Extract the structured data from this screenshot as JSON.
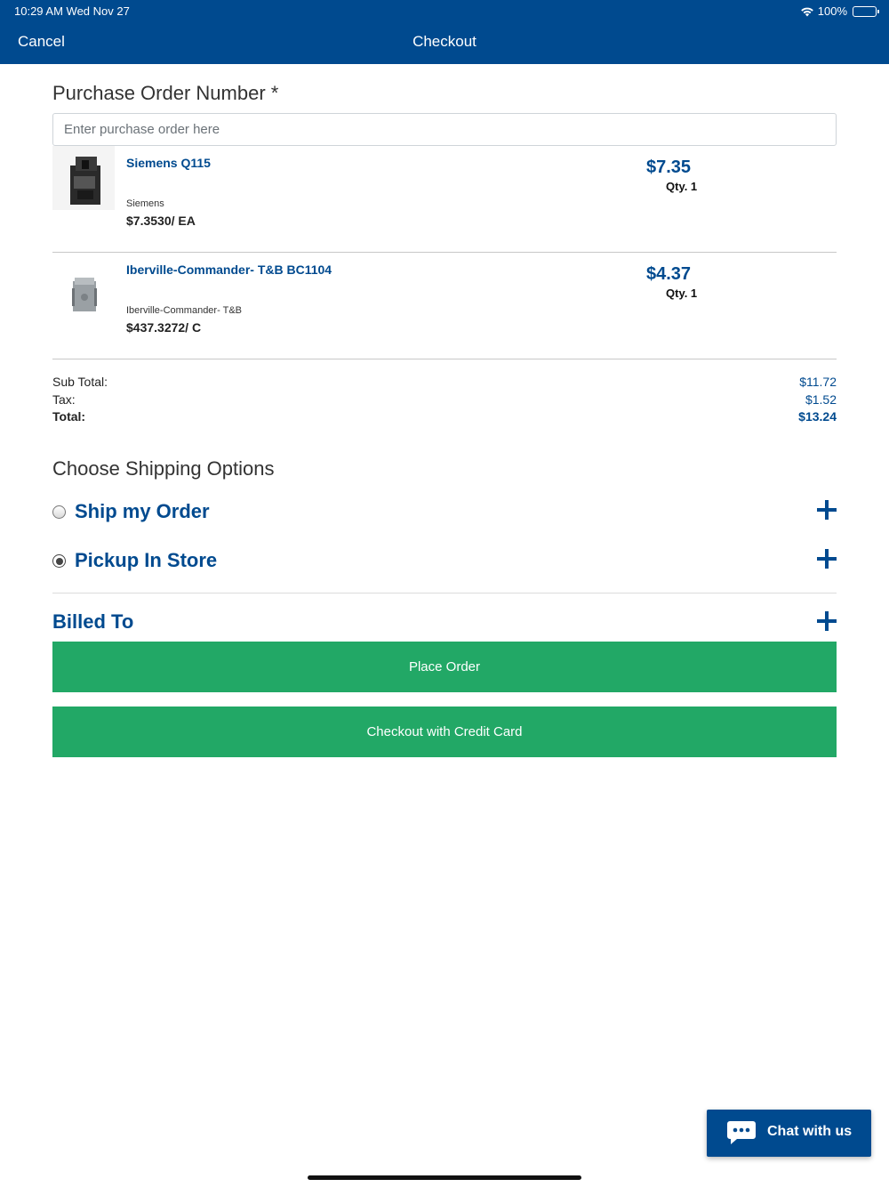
{
  "status_bar": {
    "time": "10:29 AM   Wed Nov 27",
    "battery": "100%"
  },
  "nav": {
    "cancel": "Cancel",
    "title": "Checkout"
  },
  "purchase_order": {
    "label": "Purchase Order Number *",
    "placeholder": "Enter purchase order here",
    "value": ""
  },
  "items": [
    {
      "name": "Siemens Q115",
      "manufacturer": "Siemens",
      "unit_price": "$7.3530/ EA",
      "price": "$7.35",
      "qty": "Qty. 1"
    },
    {
      "name": "Iberville-Commander- T&B BC1104",
      "manufacturer": "Iberville-Commander- T&B",
      "unit_price": "$437.3272/ C",
      "price": "$4.37",
      "qty": "Qty. 1"
    }
  ],
  "totals": {
    "subtotal_label": "Sub Total:",
    "subtotal": "$11.72",
    "tax_label": "Tax:",
    "tax": "$1.52",
    "total_label": "Total:",
    "total": "$13.24"
  },
  "shipping": {
    "heading": "Choose Shipping Options",
    "options": [
      {
        "label": "Ship my Order",
        "selected": false
      },
      {
        "label": "Pickup In Store",
        "selected": true
      }
    ]
  },
  "billing": {
    "label": "Billed To"
  },
  "actions": {
    "place_order": "Place Order",
    "credit_card": "Checkout with Credit Card"
  },
  "chat": {
    "label": "Chat with us"
  },
  "colors": {
    "brand": "#004a8f",
    "action": "#22a866"
  }
}
